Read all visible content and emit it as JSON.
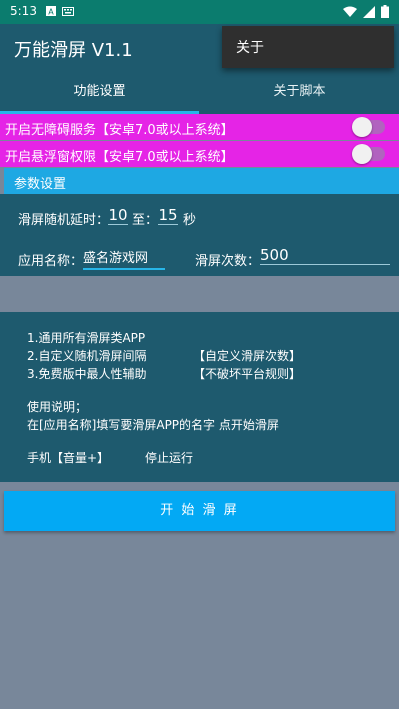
{
  "status_bar": {
    "time": "5:13",
    "left_icons": [
      "notification-a-icon",
      "keyboard-icon"
    ],
    "right_icons": [
      "wifi-icon",
      "signal-icon",
      "battery-icon"
    ]
  },
  "app_bar": {
    "title": "万能滑屏 V1.1"
  },
  "overflow_menu": {
    "items": [
      {
        "label": "关于"
      }
    ]
  },
  "tabs": [
    {
      "label": "功能设置",
      "selected": true
    },
    {
      "label": "关于脚本",
      "selected": false
    }
  ],
  "toggles": [
    {
      "label": "开启无障碍服务【安卓7.0或以上系统】",
      "on": false
    },
    {
      "label": "开启悬浮窗权限【安卓7.0或以上系统】",
      "on": false
    }
  ],
  "params": {
    "header": "参数设置",
    "delay_label": "滑屏随机延时：",
    "delay_min": "10",
    "to_label": "至：",
    "delay_max": "15",
    "seconds_label": "秒",
    "app_name_label": "应用名称：",
    "app_name_value": "盛名游戏网",
    "swipe_count_label": "滑屏次数：",
    "swipe_count_value": "500"
  },
  "info": {
    "line1": "1.通用所有滑屏类APP",
    "line2": "2.自定义随机滑屏间隔",
    "line2_right": "【自定义滑屏次数】",
    "line3": "3.免费版中最人性辅助",
    "line3_right": "【不破坏平台规则】",
    "usage_title": "使用说明；",
    "usage_text": "在[应用名称]填写要滑屏APP的名字 点开始滑屏",
    "hotkey_left": "手机【音量+】",
    "hotkey_right": "停止运行"
  },
  "start_button": {
    "label": "开 始 滑 屏"
  },
  "colors": {
    "status_bar": "#0b7c6e",
    "app_bar": "#1e5a6e",
    "toggle_bg": "#e524e6",
    "section_header": "#1ea8e3",
    "button": "#03a9f4",
    "background": "#78879a"
  }
}
